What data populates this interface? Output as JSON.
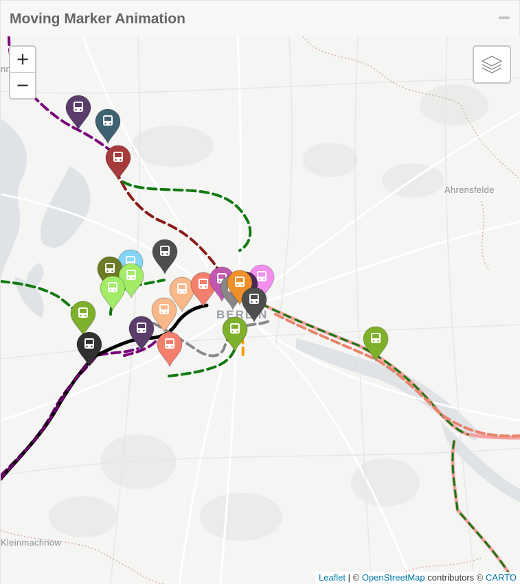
{
  "panel": {
    "title": "Moving Marker Animation"
  },
  "map": {
    "zoom_in": "+",
    "zoom_out": "−",
    "labels": {
      "top_left": "nnsdorf",
      "ahrensfelde": "Ahrensfelde",
      "city": "BERLIN",
      "kleinmachnow": "Kleinmachnow"
    },
    "attribution": {
      "leaflet": "Leaflet",
      "sep": " | © ",
      "osm": "OpenStreetMap",
      "contributors": " contributors © ",
      "carto": "CARTO"
    },
    "marker_icon": "bus-icon",
    "markers": [
      {
        "color": "#5b3d6b"
      },
      {
        "color": "#3e6271"
      },
      {
        "color": "#a73a3a"
      },
      {
        "color": "#4e4e4e"
      },
      {
        "color": "#85d4f5"
      },
      {
        "color": "#6f7a26"
      },
      {
        "color": "#a2ec67"
      },
      {
        "color": "#a2ec67"
      },
      {
        "color": "#f8b889"
      },
      {
        "color": "#f47f6c"
      },
      {
        "color": "#7fb02b"
      },
      {
        "color": "#303030"
      },
      {
        "color": "#5b3d6b"
      },
      {
        "color": "#f8b889"
      },
      {
        "color": "#f47f6c"
      },
      {
        "color": "#f48ff0"
      },
      {
        "color": "#4a2a55"
      },
      {
        "color": "#c058b0"
      },
      {
        "color": "#888888"
      },
      {
        "color": "#f0902a"
      },
      {
        "color": "#4e4e4e"
      },
      {
        "color": "#7fb02b"
      },
      {
        "color": "#7fb02b"
      }
    ],
    "routes": [
      {
        "color": "#7a007a",
        "style": "dashed"
      },
      {
        "color": "#8b1a1a",
        "style": "dashed"
      },
      {
        "color": "#117a11",
        "style": "dashed"
      },
      {
        "color": "#000000",
        "style": "solid-dashed"
      },
      {
        "color": "#f4a0a0",
        "style": "dashed"
      },
      {
        "color": "#888888",
        "style": "dashed"
      },
      {
        "color": "#f0a000",
        "style": "dashed"
      }
    ]
  }
}
